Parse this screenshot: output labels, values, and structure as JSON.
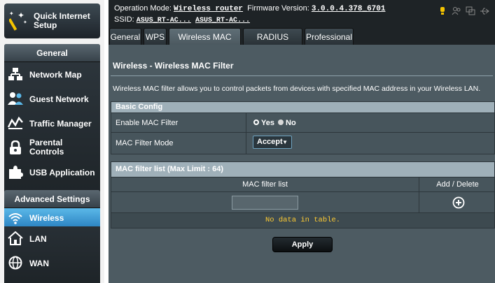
{
  "sidebar": {
    "quick_setup": "Quick Internet Setup",
    "general_header": "General",
    "general_items": [
      {
        "label": "Network Map",
        "icon": "network-map-icon"
      },
      {
        "label": "Guest Network",
        "icon": "guest-network-icon"
      },
      {
        "label": "Traffic Manager",
        "icon": "traffic-manager-icon"
      },
      {
        "label": "Parental Controls",
        "icon": "parental-controls-icon"
      },
      {
        "label": "USB Application",
        "icon": "usb-application-icon"
      }
    ],
    "advanced_header": "Advanced Settings",
    "advanced_items": [
      {
        "label": "Wireless",
        "icon": "wireless-icon",
        "active": true
      },
      {
        "label": "LAN",
        "icon": "lan-icon"
      },
      {
        "label": "WAN",
        "icon": "wan-icon"
      }
    ]
  },
  "topbar": {
    "op_mode_label": "Operation Mode:",
    "op_mode_value": "Wireless router",
    "firmware_label": "Firmware Version:",
    "firmware_value": "3.0.0.4.378_6701",
    "ssid_label": "SSID:",
    "ssid_1": "ASUS_RT-AC...",
    "ssid_2": "ASUS_RT-AC..."
  },
  "tabs": [
    {
      "label": "General"
    },
    {
      "label": "WPS"
    },
    {
      "label": "Wireless MAC Filter",
      "active": true
    },
    {
      "label": "RADIUS Setting"
    },
    {
      "label": "Professional"
    }
  ],
  "main": {
    "title": "Wireless - Wireless MAC Filter",
    "description": "Wireless MAC filter allows you to control packets from devices with specified MAC address in your Wireless LAN.",
    "basic_config": {
      "header": "Basic Config",
      "enable_label": "Enable MAC Filter",
      "yes_label": "Yes",
      "no_label": "No",
      "enabled": true,
      "mode_label": "MAC Filter Mode",
      "mode_value": "Accept"
    },
    "mac_list": {
      "header": "MAC filter list (Max Limit : 64)",
      "col_list": "MAC filter list",
      "col_action": "Add / Delete",
      "input_value": "",
      "empty_text": "No data in table."
    },
    "apply_label": "Apply"
  },
  "colors": {
    "active_nav": "#2e86c4",
    "panel_bg": "#4d5b62",
    "empty_text": "#ffcc33"
  }
}
